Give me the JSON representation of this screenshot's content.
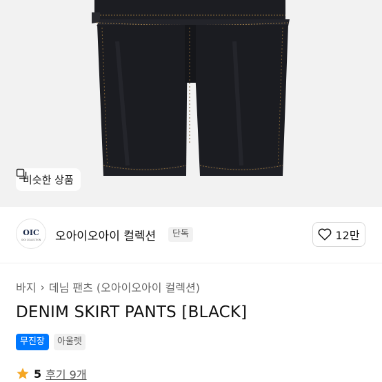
{
  "hero": {
    "similar_label": "비슷한 상품"
  },
  "brand": {
    "logo_text": "OIC",
    "logo_subtext": "OIOI COLLECTION",
    "name": "오아이오아이 컬렉션",
    "exclusive_badge": "단독",
    "like_count": "12만"
  },
  "breadcrumb": {
    "category": "바지",
    "separator": "›",
    "subcategory": "데님 팬츠 (오아이오아이 컬렉션)"
  },
  "product": {
    "title": "DENIM SKIRT PANTS [BLACK]",
    "tag_store": "무진장",
    "tag_outlet": "아울렛",
    "rating": "5",
    "reviews": "후기 9개"
  },
  "colors": {
    "accent": "#0078ff",
    "star": "#f5a623",
    "denim": "#1c1d22"
  }
}
